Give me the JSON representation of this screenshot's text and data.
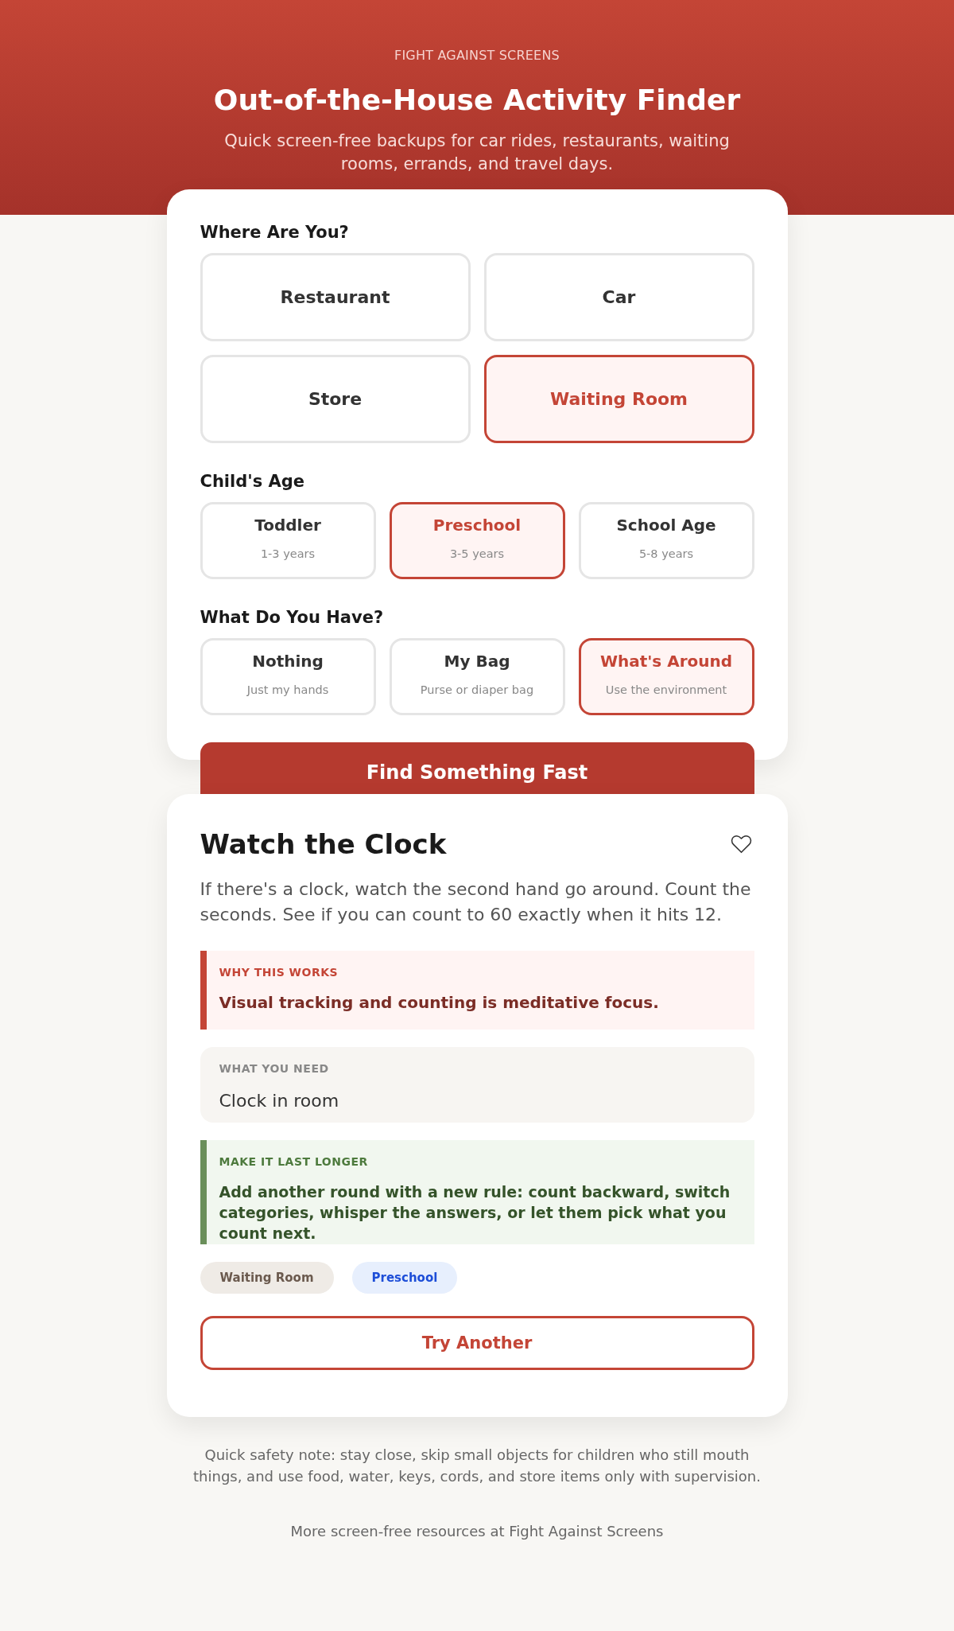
{
  "header": {
    "brand": "FIGHT AGAINST SCREENS",
    "title": "Out-of-the-House Activity Finder",
    "subtitle": "Quick screen-free backups for car rides, restaurants, waiting rooms, errands, and travel days."
  },
  "finder": {
    "sections": [
      {
        "heading": "Where Are You?",
        "kind": "large",
        "options": [
          {
            "label": "Restaurant",
            "selected": false
          },
          {
            "label": "Car",
            "selected": false
          },
          {
            "label": "Store",
            "selected": false
          },
          {
            "label": "Waiting Room",
            "selected": true
          }
        ]
      },
      {
        "heading": "Child's Age",
        "kind": "compact",
        "options": [
          {
            "label": "Toddler",
            "detail": "1-3 years",
            "selected": false
          },
          {
            "label": "Preschool",
            "detail": "3-5 years",
            "selected": true
          },
          {
            "label": "School Age",
            "detail": "5-8 years",
            "selected": false
          }
        ]
      },
      {
        "heading": "What Do You Have?",
        "kind": "compact",
        "options": [
          {
            "label": "Nothing",
            "detail": "Just my hands",
            "selected": false
          },
          {
            "label": "My Bag",
            "detail": "Purse or diaper bag",
            "selected": false
          },
          {
            "label": "What's Around",
            "detail": "Use the environment",
            "selected": true
          }
        ]
      }
    ],
    "find_button": "Find Something Fast"
  },
  "result": {
    "title": "Watch the Clock",
    "favorite": false,
    "description": "If there's a clock, watch the second hand go around. Count the seconds. See if you can count to 60 exactly when it hits 12.",
    "why_it_works": {
      "label": "WHY THIS WORKS",
      "text": "Visual tracking and counting is meditative focus."
    },
    "what_you_need": {
      "label": "WHAT YOU NEED",
      "text": "Clock in room"
    },
    "make_it_last_longer": {
      "label": "MAKE IT LAST LONGER",
      "text": "Add another round with a new rule: count backward, switch categories, whisper the answers, or let them pick what you count next."
    },
    "tags": [
      {
        "label": "Waiting Room",
        "kind": "place"
      },
      {
        "label": "Preschool",
        "kind": "age"
      }
    ],
    "try_button": "Try Another"
  },
  "footer": {
    "safety_note": "Quick safety note: stay close, skip small objects for children who still mouth things, and use food, water, keys, cords, and store items only with supervision.",
    "resources": "More screen-free resources at Fight Against Screens"
  }
}
